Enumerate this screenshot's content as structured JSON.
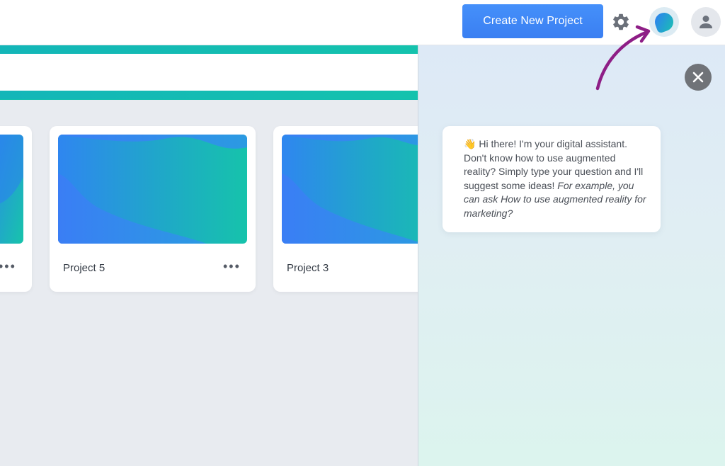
{
  "header": {
    "create_button_label": "Create New Project"
  },
  "projects": [
    {
      "title": "Project 5",
      "menu": "•••"
    },
    {
      "title": "Project 3",
      "menu": ""
    }
  ],
  "partial_card": {
    "menu": "•••"
  },
  "assistant": {
    "message_emoji": "👋",
    "message_text": "Hi there! I'm your digital assistant. Don't know how to use augmented reality? Simply type your question and I'll suggest some ideas! ",
    "message_italic": "For example, you can ask How to use augmented reality for marketing?"
  },
  "icons": {
    "settings": "gear-icon",
    "assistant": "assistant-icon",
    "profile": "user-icon",
    "close": "close-icon",
    "card_menu": "more-horizontal-icon"
  },
  "colors": {
    "primary": "#3b82f6",
    "teal_accent": "#14bfb0",
    "annotation": "#8e1e86"
  }
}
